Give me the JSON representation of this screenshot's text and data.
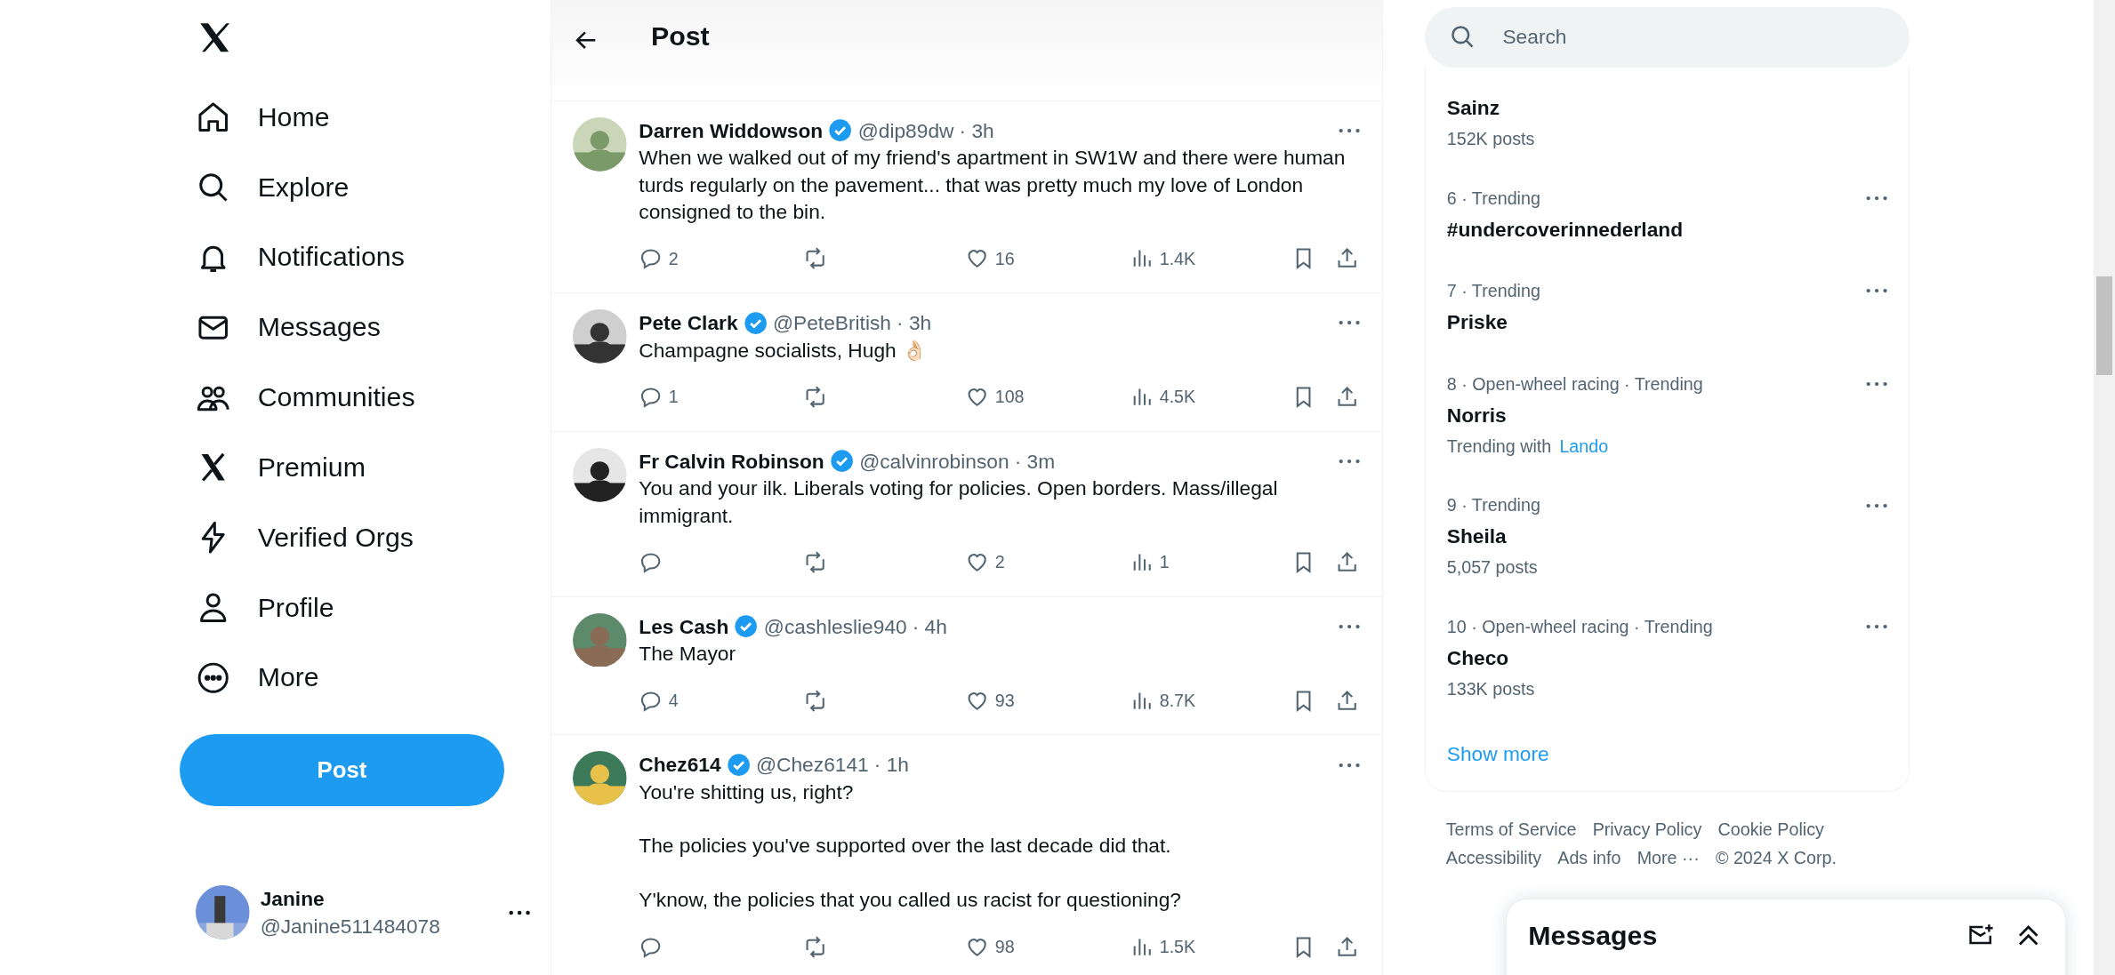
{
  "nav": {
    "items": [
      {
        "label": "Home",
        "kind": "home",
        "selected": false
      },
      {
        "label": "Explore",
        "kind": "search",
        "selected": false
      },
      {
        "label": "Notifications",
        "kind": "bell",
        "selected": false
      },
      {
        "label": "Messages",
        "kind": "mail",
        "selected": false
      },
      {
        "label": "Communities",
        "kind": "people",
        "selected": false
      },
      {
        "label": "Premium",
        "kind": "x",
        "selected": false
      },
      {
        "label": "Verified Orgs",
        "kind": "bolt",
        "selected": false
      },
      {
        "label": "Profile",
        "kind": "person",
        "selected": false
      },
      {
        "label": "More",
        "kind": "more",
        "selected": false
      }
    ],
    "post_button": "Post"
  },
  "account": {
    "name": "Janine",
    "handle": "@Janine511484078"
  },
  "header": {
    "title": "Post"
  },
  "tweets": [
    {
      "name": "Darren Widdowson",
      "verified": true,
      "handle": "@dip89dw",
      "time": "· 3h",
      "paragraphs": [
        "When we walked out of my friend's apartment in SW1W and there were human turds regularly on the pavement... that was pretty much my love of London consigned to the bin."
      ],
      "replies": "2",
      "likes": "16",
      "views": "1.4K"
    },
    {
      "name": "Pete Clark",
      "verified": true,
      "handle": "@PeteBritish",
      "time": "· 3h",
      "paragraphs": [
        "Champagne socialists, Hugh 👌🏻"
      ],
      "replies": "1",
      "likes": "108",
      "views": "4.5K"
    },
    {
      "name": "Fr Calvin Robinson",
      "verified": true,
      "handle": "@calvinrobinson",
      "time": "· 3m",
      "paragraphs": [
        "You and your ilk. Liberals voting for policies. Open borders. Mass/illegal immigrant."
      ],
      "likes": "2",
      "views": "1"
    },
    {
      "name": "Les Cash",
      "verified": true,
      "handle": "@cashleslie940",
      "time": "· 4h",
      "paragraphs": [
        "The Mayor"
      ],
      "replies": "4",
      "likes": "93",
      "views": "8.7K"
    },
    {
      "name": "Chez614",
      "verified": true,
      "handle": "@Chez6141",
      "time": "· 1h",
      "paragraphs": [
        "You're shitting us, right?",
        "The policies you've supported over the last decade did that.",
        "Y'know, the policies that you called us racist for questioning?"
      ],
      "likes": "98",
      "views": "1.5K"
    }
  ],
  "search": {
    "placeholder": "Search"
  },
  "trends": [
    {
      "name": "Sainz",
      "posts": "152K posts"
    },
    {
      "meta": "6 · Trending",
      "name": "#undercoverinnederland"
    },
    {
      "meta": "7 · Trending",
      "name": "Priske"
    },
    {
      "meta": "8 · Open-wheel racing · Trending",
      "name": "Norris",
      "with_label": "Trending with",
      "with_link": "Lando"
    },
    {
      "meta": "9 · Trending",
      "name": "Sheila",
      "posts": "5,057 posts"
    },
    {
      "meta": "10 · Open-wheel racing · Trending",
      "name": "Checo",
      "posts": "133K posts"
    }
  ],
  "show_more": "Show more",
  "footer": {
    "links": [
      "Terms of Service",
      "Privacy Policy",
      "Cookie Policy",
      "Accessibility",
      "Ads info",
      "More ···"
    ],
    "copyright": "© 2024 X Corp."
  },
  "messages_drawer": {
    "title": "Messages"
  }
}
